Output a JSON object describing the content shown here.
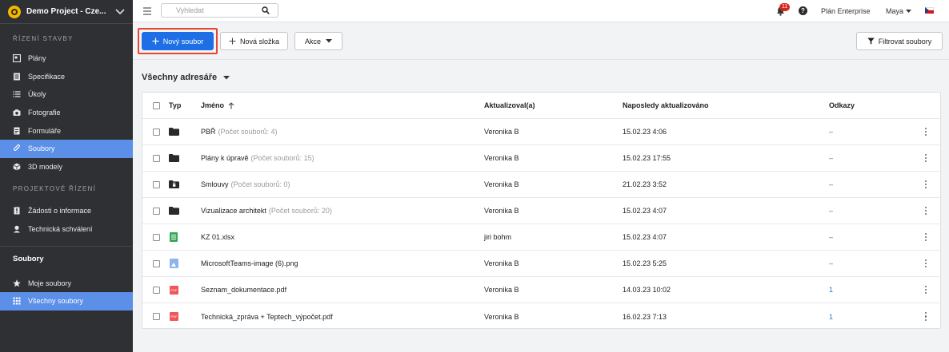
{
  "project": {
    "name": "Demo Project - Cze..."
  },
  "sidebar": {
    "section1_title": "ŘÍZENÍ STAVBY",
    "section1_items": [
      {
        "label": "Plány",
        "icon": "plans-icon"
      },
      {
        "label": "Specifikace",
        "icon": "specification-icon"
      },
      {
        "label": "Úkoly",
        "icon": "tasks-icon"
      },
      {
        "label": "Fotografie",
        "icon": "camera-icon"
      },
      {
        "label": "Formuláře",
        "icon": "forms-icon"
      },
      {
        "label": "Soubory",
        "icon": "paperclip-icon",
        "active": true
      },
      {
        "label": "3D modely",
        "icon": "cube-icon"
      }
    ],
    "section2_title": "PROJEKTOVÉ ŘÍZENÍ",
    "section2_items": [
      {
        "label": "Žádosti o informace",
        "icon": "rfi-icon"
      },
      {
        "label": "Technická schválení",
        "icon": "person-icon"
      }
    ],
    "files_title": "Soubory",
    "files_items": [
      {
        "label": "Moje soubory",
        "icon": "star-icon"
      },
      {
        "label": "Všechny soubory",
        "icon": "grid-icon",
        "active": true
      }
    ]
  },
  "topbar": {
    "search_placeholder": "Vyhledat",
    "notifications_count": "11",
    "plan_label": "Plán Enterprise",
    "user_name": "Maya"
  },
  "toolbar": {
    "new_file_label": "Nový soubor",
    "new_folder_label": "Nová složka",
    "actions_label": "Akce",
    "filter_label": "Filtrovat soubory"
  },
  "content": {
    "directory_selector": "Všechny adresáře",
    "columns": {
      "type": "Typ",
      "name": "Jméno",
      "updated_by": "Aktualizoval(a)",
      "last_updated": "Naposledy aktualizováno",
      "links": "Odkazy"
    },
    "rows": [
      {
        "type": "folder",
        "name": "PBŘ",
        "count": "(Počet souborů: 4)",
        "updated_by": "Veronika B",
        "date": "15.02.23 4:06",
        "links": "–"
      },
      {
        "type": "folder",
        "name": "Plány k úpravě",
        "count": "(Počet souborů: 15)",
        "updated_by": "Veronika B",
        "date": "15.02.23 17:55",
        "links": "–"
      },
      {
        "type": "locked-folder",
        "name": "Smlouvy",
        "count": "(Počet souborů: 0)",
        "updated_by": "Veronika B",
        "date": "21.02.23 3:52",
        "links": "–"
      },
      {
        "type": "folder",
        "name": "Vizualizace architekt",
        "count": "(Počet souborů: 20)",
        "updated_by": "Veronika B",
        "date": "15.02.23 4:07",
        "links": "–"
      },
      {
        "type": "xlsx",
        "name": "KZ 01.xlsx",
        "count": "",
        "updated_by": "jiri bohm",
        "date": "15.02.23 4:07",
        "links": "–"
      },
      {
        "type": "png",
        "name": "MicrosoftTeams-image (6).png",
        "count": "",
        "updated_by": "Veronika B",
        "date": "15.02.23 5:25",
        "links": "–"
      },
      {
        "type": "pdf",
        "name": "Seznam_dokumentace.pdf",
        "count": "",
        "updated_by": "Veronika B",
        "date": "14.03.23 10:02",
        "links": "1"
      },
      {
        "type": "pdf",
        "name": "Technická_zpráva + Teptech_výpočet.pdf",
        "count": "",
        "updated_by": "Veronika B",
        "date": "16.02.23 7:13",
        "links": "1"
      }
    ],
    "pdf_icon_text": "PDF"
  },
  "colors": {
    "sidebar_bg": "#2e3033",
    "active_item": "#5b8fe8",
    "primary": "#1e6fe6",
    "highlight": "#e8442e"
  }
}
